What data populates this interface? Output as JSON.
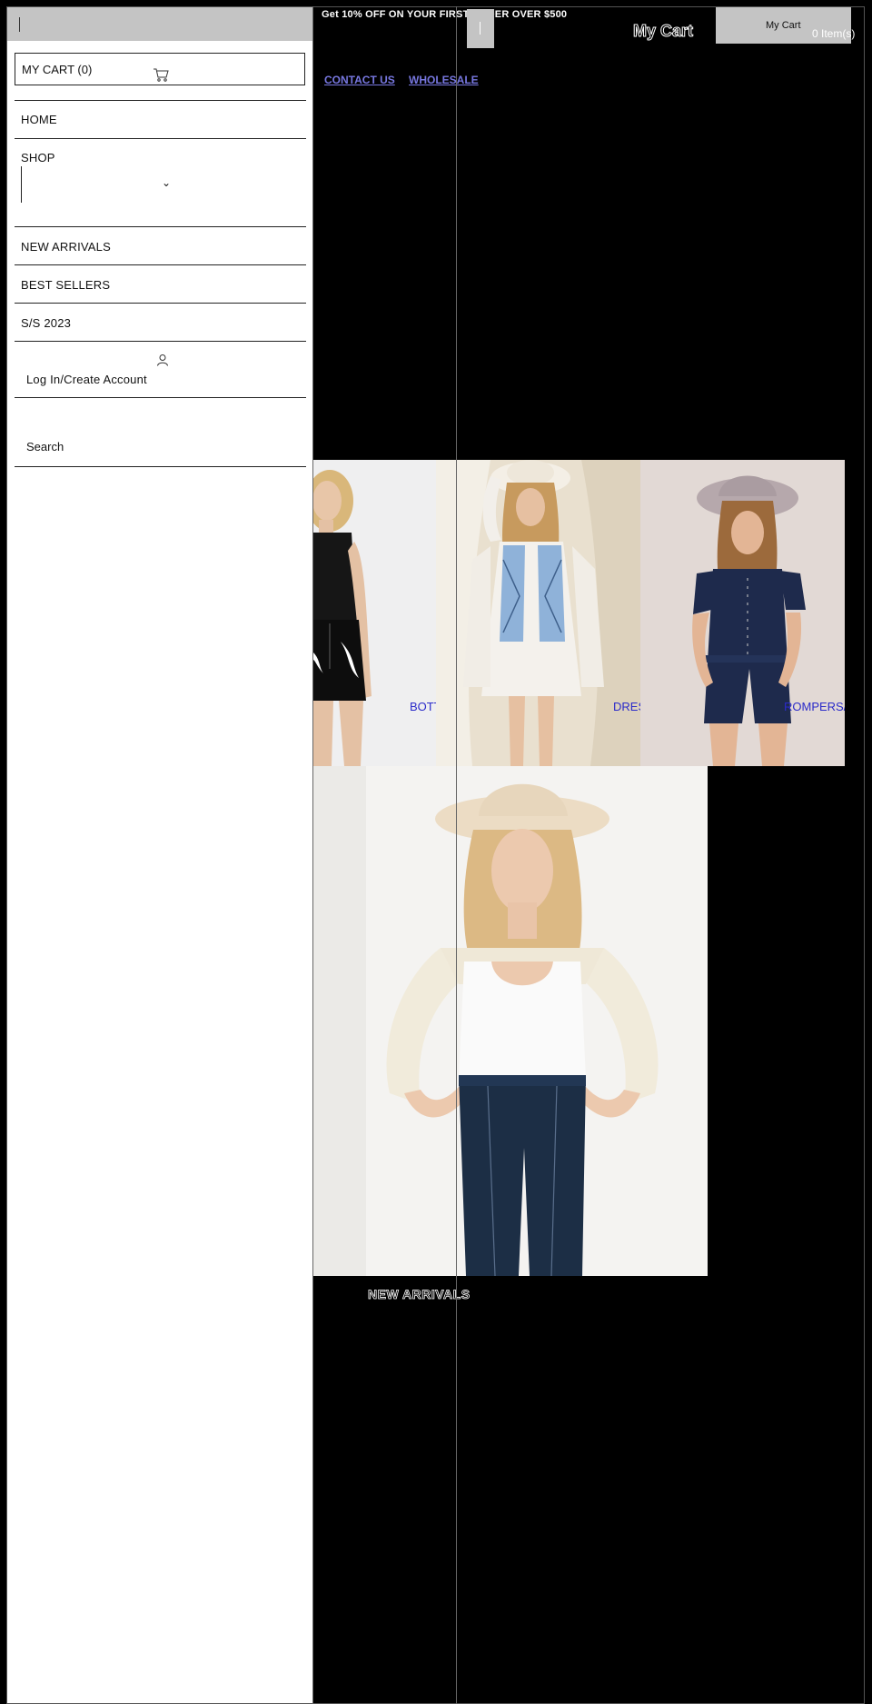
{
  "drawer": {
    "cart_label": "MY CART (0)",
    "nav": {
      "home": "HOME",
      "shop": "SHOP",
      "new_arrivals": "NEW ARRIVALS",
      "best_sellers": "BEST SELLERS",
      "ss2023": "S/S 2023"
    },
    "account_label": "Log In/Create Account",
    "search_label": "Search"
  },
  "header": {
    "promo": "Get 10% OFF ON YOUR FIRST ORDER OVER $500",
    "my_cart_title": "My Cart",
    "cart_button_label": "My Cart",
    "items_count": "0 Item(s)",
    "links": [
      "CONTACT US",
      "WHOLESALE"
    ]
  },
  "collections": [
    {
      "label": "BOTT"
    },
    {
      "label": "DRES"
    },
    {
      "label": "ROMPERS/J"
    }
  ],
  "featured": {
    "heading": "NEW ARRIVALS"
  },
  "colors": {
    "drawer_bg": "#ffffff",
    "page_bg": "#000000",
    "gray_bar": "#c4c4c4",
    "link_color": "#7777e0",
    "collection_label": "#2b2bc9"
  }
}
